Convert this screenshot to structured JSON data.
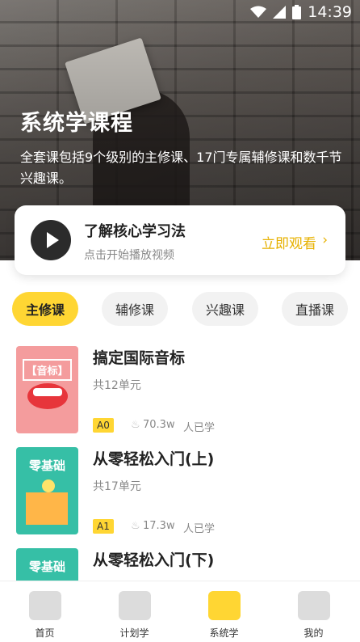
{
  "status_bar": {
    "time": "14:39"
  },
  "hero": {
    "title": "系统学课程",
    "description": "全套课包括9个级别的主修课、17门专属辅修课和数千节兴趣课。"
  },
  "video_card": {
    "title": "了解核心学习法",
    "subtitle": "点击开始播放视频",
    "action": "立即观看",
    "arrow": "›"
  },
  "tabs": [
    {
      "label": "主修课",
      "active": true
    },
    {
      "label": "辅修课",
      "active": false
    },
    {
      "label": "兴趣课",
      "active": false
    },
    {
      "label": "直播课",
      "active": false
    }
  ],
  "courses": [
    {
      "cover_text": "【音标】",
      "title": "搞定国际音标",
      "units": "共12单元",
      "level": "A0",
      "learners": "70.3w",
      "learned_label": "人已学"
    },
    {
      "cover_text": "零基础",
      "title": "从零轻松入门(上)",
      "units": "共17单元",
      "level": "A1",
      "learners": "17.3w",
      "learned_label": "人已学"
    },
    {
      "cover_text": "零基础",
      "title": "从零轻松入门(下)"
    }
  ],
  "bottom_nav": [
    {
      "label": "首页",
      "icon": "book-icon",
      "active": false
    },
    {
      "label": "计划学",
      "icon": "clipboard-icon",
      "active": false
    },
    {
      "label": "系统学",
      "icon": "grid-book-icon",
      "active": true
    },
    {
      "label": "我的",
      "icon": "person-icon",
      "active": false
    }
  ],
  "colors": {
    "accent": "#ffd633",
    "link": "#e7b100"
  }
}
